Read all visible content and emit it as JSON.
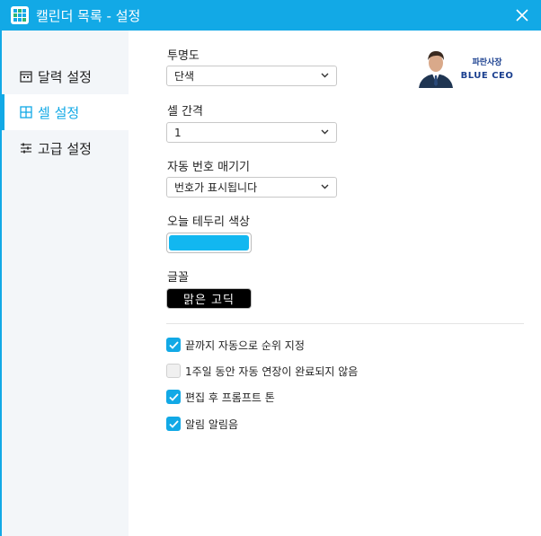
{
  "window": {
    "title": "캘린더 목록 - 설정"
  },
  "sidebar": {
    "items": [
      {
        "label": "달력 설정",
        "icon": "calendar-icon"
      },
      {
        "label": "셀 설정",
        "icon": "grid-icon"
      },
      {
        "label": "고급 설정",
        "icon": "sliders-icon"
      }
    ],
    "active": "셀 설정"
  },
  "settings": {
    "opacity": {
      "label": "투명도",
      "value": "단색"
    },
    "cell_spacing": {
      "label": "셀 간격",
      "value": "1"
    },
    "auto_number": {
      "label": "자동 번호 매기기",
      "value": "번호가 표시됩니다"
    },
    "today_border": {
      "label": "오늘 테두리 색상",
      "color": "#12b7f0"
    },
    "font": {
      "label": "글꼴",
      "value": "맑은 고딕"
    }
  },
  "checkboxes": [
    {
      "label": "끝까지 자동으로 순위 지정",
      "checked": true
    },
    {
      "label": "1주일 동안 자동 연장이 완료되지 않음",
      "checked": false
    },
    {
      "label": "편집 후 프롬프트 톤",
      "checked": true
    },
    {
      "label": "알림 알림음",
      "checked": true
    }
  ],
  "brand": {
    "line1": "파란사장",
    "line2": "BLUE CEO"
  },
  "colors": {
    "accent": "#12a9e6",
    "sidebar_bg": "#f3f6f9"
  }
}
